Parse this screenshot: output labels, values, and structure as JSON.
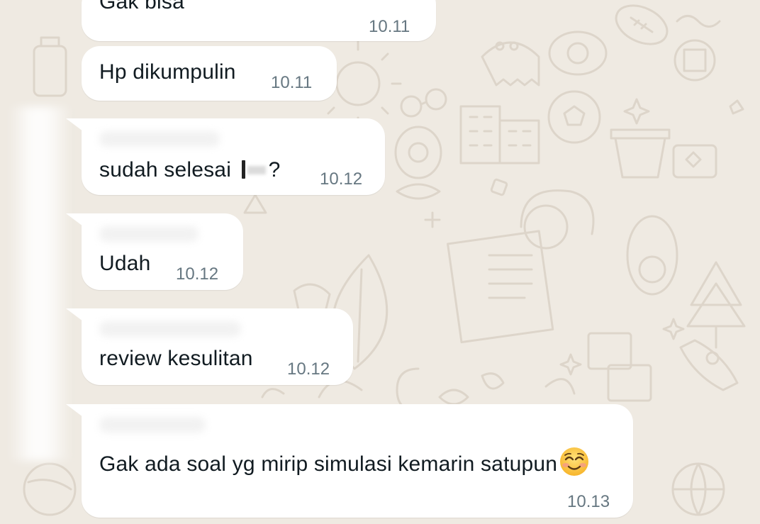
{
  "messages": [
    {
      "text": "Gak bisa",
      "time": "10.11"
    },
    {
      "text": "Hp dikumpulin",
      "time": "10.11"
    },
    {
      "text_before": "sudah selesai ",
      "text_after": "?",
      "time": "10.12"
    },
    {
      "text": "Udah",
      "time": "10.12"
    },
    {
      "text": "review kesulitan",
      "time": "10.12"
    },
    {
      "text": "Gak ada soal yg mirip simulasi kemarin satupun",
      "time": "10.13",
      "emoji": "smiling-face-with-smiling-eyes"
    }
  ],
  "colors": {
    "background": "#efeae2",
    "bubble": "#ffffff",
    "text": "#111b21",
    "time": "#667781"
  }
}
